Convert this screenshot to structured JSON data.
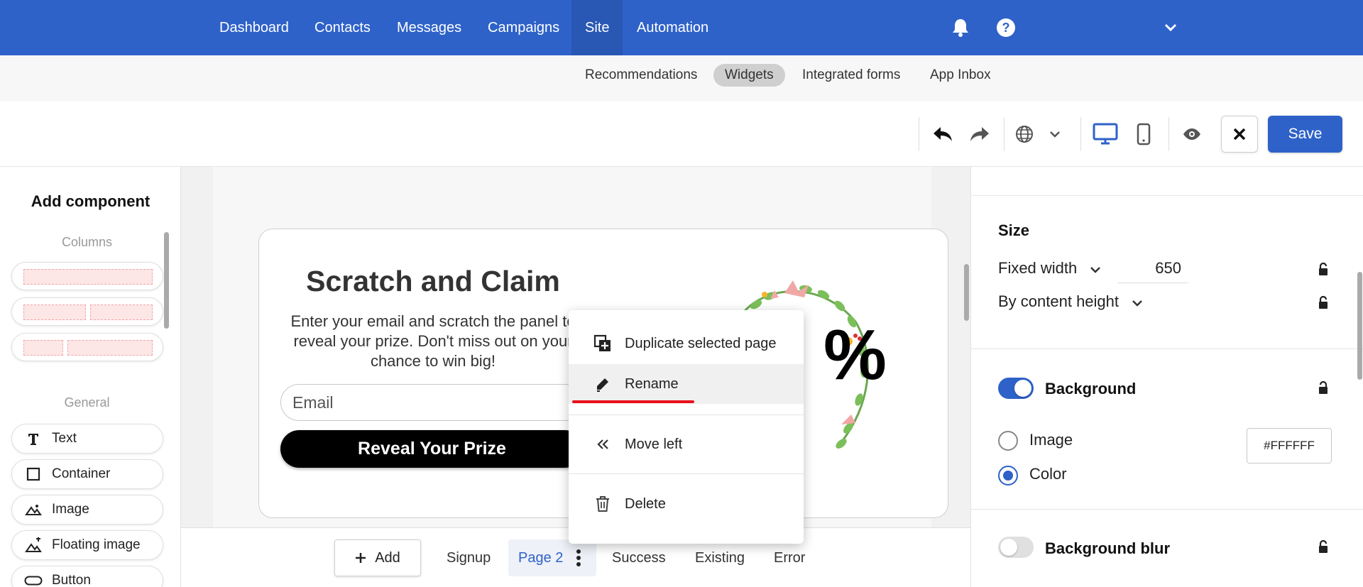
{
  "topnav": {
    "items": [
      "Dashboard",
      "Contacts",
      "Messages",
      "Campaigns",
      "Site",
      "Automation"
    ],
    "active": "Site"
  },
  "subnav": {
    "items": [
      "Recommendations",
      "Widgets",
      "Integrated forms",
      "App Inbox"
    ],
    "active": "Widgets"
  },
  "toolbar": {
    "save_label": "Save"
  },
  "left_panel": {
    "title": "Add component",
    "columns_label": "Columns",
    "general_label": "General",
    "components": [
      "Text",
      "Container",
      "Image",
      "Floating image",
      "Button"
    ]
  },
  "widget": {
    "title": "Scratch and Claim",
    "description": "Enter your email and scratch the panel to reveal your prize. Don't miss out on your chance to win big!",
    "email_placeholder": "Email",
    "cta_label": "Reveal Your Prize",
    "prize_fragment": "%"
  },
  "context_menu": {
    "items": [
      "Duplicate selected page",
      "Rename",
      "Move left",
      "Delete"
    ],
    "highlighted": "Rename"
  },
  "page_bar": {
    "add_label": "Add",
    "pages": [
      "Signup",
      "Page 2",
      "Success",
      "Existing",
      "Error"
    ],
    "active": "Page 2"
  },
  "right_panel": {
    "size_heading": "Size",
    "width_mode": "Fixed width",
    "width_value": "650",
    "height_mode": "By content height",
    "background_heading": "Background",
    "background_enabled": true,
    "bg_option_image": "Image",
    "bg_option_color": "Color",
    "bg_selected": "Color",
    "bg_color": "#FFFFFF",
    "blur_heading": "Background blur",
    "blur_enabled": false
  },
  "colors": {
    "brand": "#2e62c9",
    "highlight_underline": "#e8101a"
  }
}
